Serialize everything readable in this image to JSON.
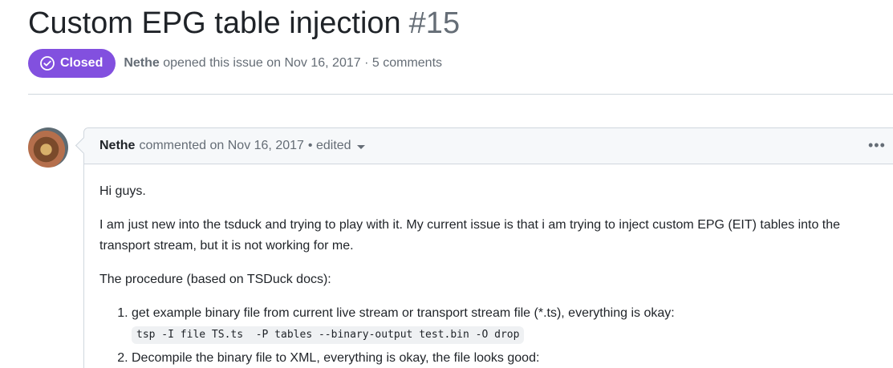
{
  "issue": {
    "title": "Custom EPG table injection",
    "number": "#15",
    "state_label": "Closed",
    "author": "Nethe",
    "meta_text": "opened this issue on Nov 16, 2017 · 5 comments"
  },
  "comment": {
    "author": "Nethe",
    "header_text": "commented on Nov 16, 2017",
    "edited_label": "• edited",
    "more_label": "•••",
    "paragraphs": [
      "Hi guys.",
      "I am just new into the tsduck and trying to play with it. My current issue is that i am trying to inject custom EPG (EIT) tables into the transport stream, but it is not working for me.",
      "The procedure (based on TSDuck docs):"
    ],
    "steps": [
      {
        "text": "get example binary file from current live stream or transport stream file (*.ts), everything is okay:",
        "code": "tsp -I file TS.ts  -P tables --binary-output test.bin -O drop"
      },
      {
        "text": "Decompile the binary file to XML, everything is okay, the file looks good:"
      }
    ]
  },
  "colors": {
    "closed_badge": "#8250df",
    "text_muted": "#656d76",
    "border": "#d0d7de"
  }
}
